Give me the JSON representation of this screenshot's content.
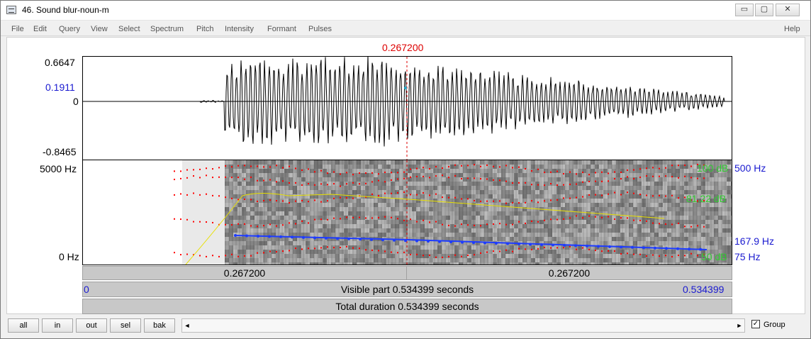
{
  "window": {
    "title": "46. Sound blur-noun-m",
    "controls": [
      "▭",
      "▢",
      "✕"
    ]
  },
  "menu": {
    "items": [
      "File",
      "Edit",
      "Query",
      "View",
      "Select",
      "Spectrum",
      "Pitch",
      "Intensity",
      "Formant",
      "Pulses"
    ],
    "help": "Help"
  },
  "cursor": {
    "time_label": "0.267200",
    "color": "#dd0000"
  },
  "waveform": {
    "max_label": "0.6647",
    "cursor_value": "0.1911",
    "zero_label": "0",
    "min_label": "-0.8465"
  },
  "spectrogram": {
    "max_freq": "5000 Hz",
    "min_freq": "0 Hz",
    "pitch_top": "500 Hz",
    "pitch_value": "167.9 Hz",
    "pitch_bottom": "75 Hz",
    "intensity_top": "100 dB",
    "intensity_value": "81.22 dB",
    "intensity_bottom": "50 dB"
  },
  "timebars": {
    "left_half": "0.267200",
    "right_half": "0.267200",
    "start": "0",
    "visible": "Visible part 0.534399 seconds",
    "end": "0.534399",
    "total": "Total duration 0.534399 seconds"
  },
  "navigation": {
    "buttons": [
      "all",
      "in",
      "out",
      "sel",
      "bak"
    ],
    "scroll_left": "◄",
    "scroll_right": "►",
    "group_label": "Group",
    "group_checked": "✓"
  },
  "colors": {
    "pitch": "#1e3cff",
    "intensity": "#e8e000",
    "formant": "#ff0000",
    "db_labels": "#33cc33",
    "hz_labels": "#1a1ad0"
  }
}
